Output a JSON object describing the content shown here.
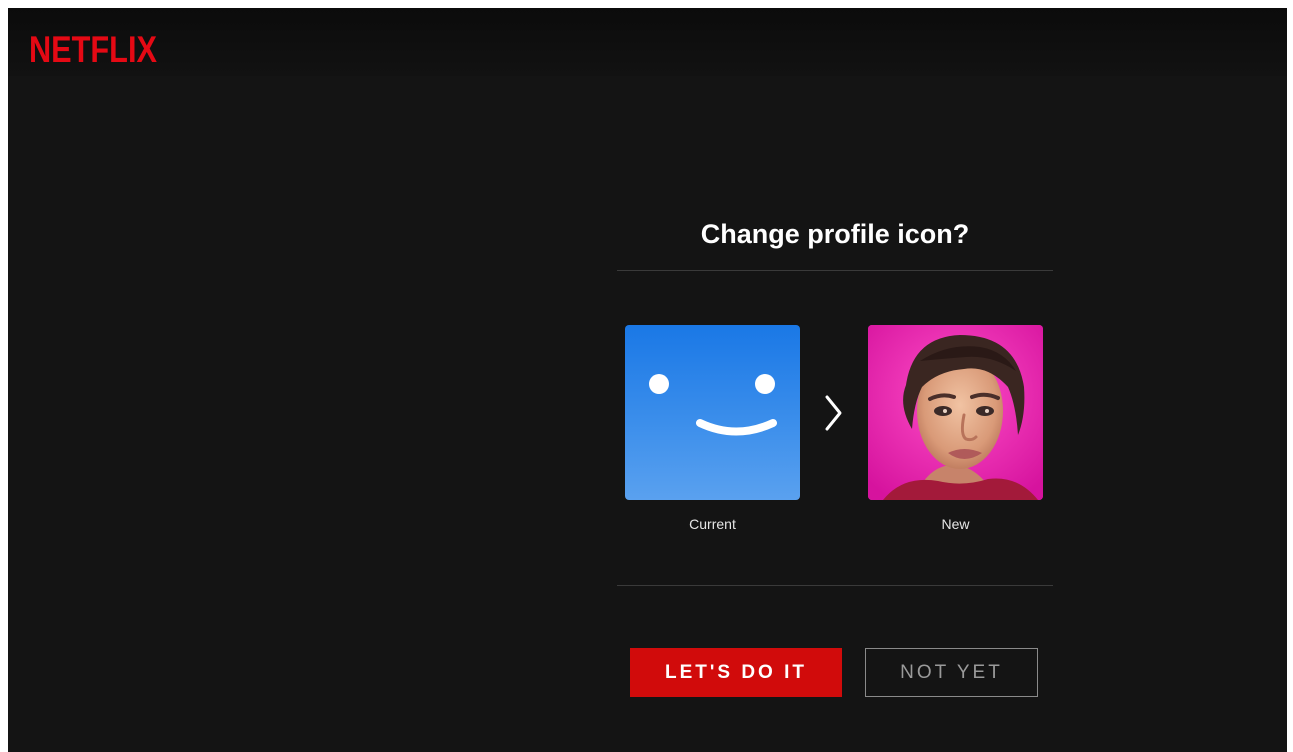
{
  "app": {
    "logo_text": "NETFLIX",
    "brand_color": "#e50914"
  },
  "dialog": {
    "title": "Change profile icon?",
    "current_label": "Current",
    "new_label": "New",
    "arrow_icon": "chevron-right-icon",
    "primary_button": "LET'S DO IT",
    "secondary_button": "NOT YET",
    "colors": {
      "background": "#141414",
      "primary_button": "#d10b0b",
      "current_avatar": "#2f86ea",
      "new_avatar_bg": "#e81fb0"
    }
  }
}
